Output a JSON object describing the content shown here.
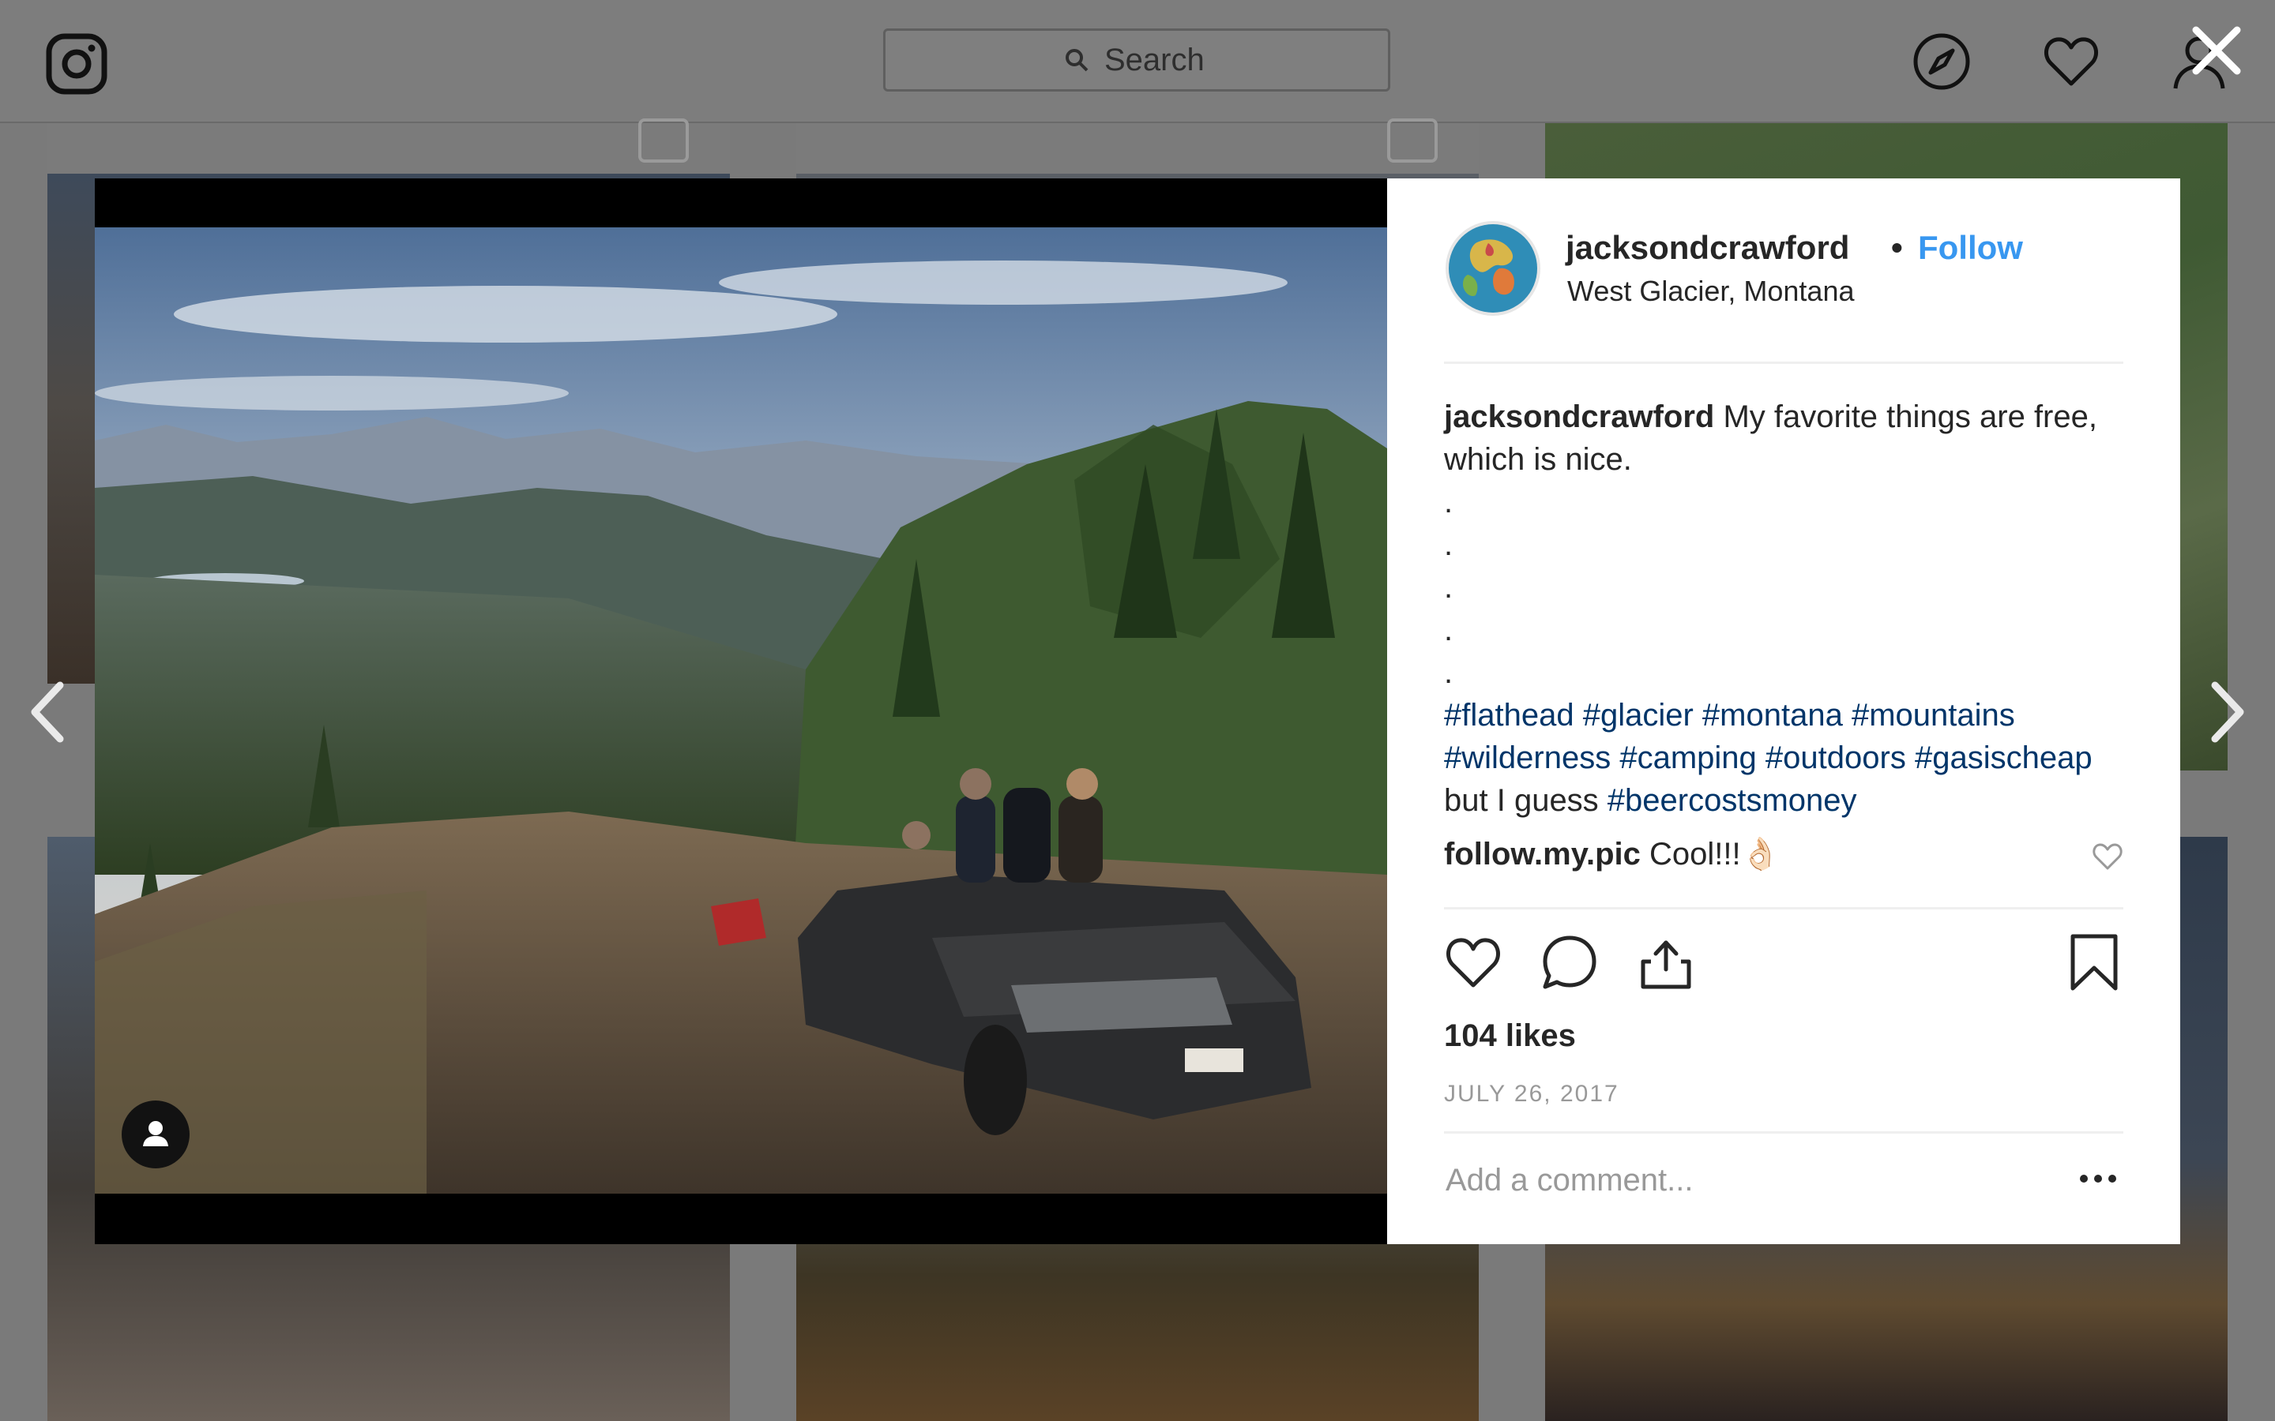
{
  "header": {
    "search_placeholder": "Search"
  },
  "post": {
    "username": "jacksondcrawford",
    "separator": "•",
    "follow_label": "Follow",
    "location": "West Glacier, Montana",
    "caption": {
      "username": "jacksondcrawford",
      "text_line1": " My favorite things are free, which is nice.",
      "dots": [
        ".",
        ".",
        ".",
        ".",
        "."
      ],
      "hashtags_line1": [
        "#flathead",
        "#glacier",
        "#montana",
        "#mountains"
      ],
      "hashtags_line2": [
        "#wilderness",
        "#camping",
        "#outdoors",
        "#gasischeap"
      ],
      "tail_text": "but I guess ",
      "tail_hashtag": "#beercostsmoney"
    },
    "comment": {
      "username": "follow.my.pic",
      "text": "Cool!!!👌🏻"
    },
    "likes": "104 likes",
    "date": "JULY 26, 2017",
    "add_comment_placeholder": "Add a comment..."
  },
  "colors": {
    "link_blue": "#3897f0",
    "hashtag": "#003569",
    "overlay": "#7a7a7a"
  },
  "icons": [
    "instagram-logo-icon",
    "search-icon",
    "compass-icon",
    "heart-icon",
    "profile-icon",
    "close-icon",
    "chevron-left-icon",
    "chevron-right-icon",
    "user-tag-icon",
    "like-icon",
    "comment-icon",
    "share-icon",
    "bookmark-icon",
    "more-options-icon"
  ]
}
